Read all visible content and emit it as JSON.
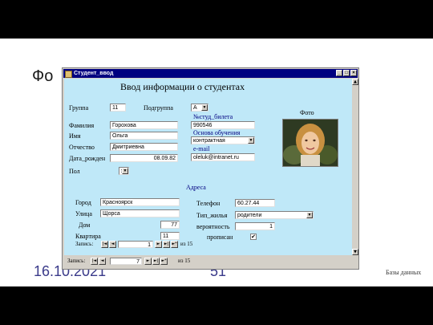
{
  "slide": {
    "title": "Фо",
    "date": "16.10.2021",
    "page": "51",
    "note": "Базы данных"
  },
  "window": {
    "title": "Студент_ввод",
    "minimize": "_",
    "maximize": "□",
    "close": "×"
  },
  "form": {
    "heading": "Ввод информации о студентах",
    "group_label": "Группа",
    "group_value": "11",
    "subgroup_label": "Подгруппа",
    "subgroup_value": "А",
    "surname_label": "Фамилия",
    "surname_value": "Горохова",
    "name_label": "Имя",
    "name_value": "Ольга",
    "patronymic_label": "Отчество",
    "patronymic_value": "Дмитриевна",
    "birthdate_label": "Дата_рожден",
    "birthdate_value": "08.09.82",
    "sex_label": "Пол",
    "sex_value": "ж",
    "ticket_label": "№студ_билета",
    "ticket_value": "990546",
    "study_basis_label": "Основа обучения",
    "study_basis_value": "контрактная",
    "email_label": "e-mail",
    "email_value": "oleluk@intranet.ru",
    "photo_label": "Фото",
    "address_heading": "Адреса",
    "city_label": "Город",
    "city_value": "Красноярск",
    "street_label": "Улица",
    "street_value": "Щорса",
    "house_label": "Дом",
    "house_value": "77",
    "apartment_label": "Квартира",
    "apartment_value": "11",
    "phone_label": "Телефон",
    "phone_value": "60.27.44",
    "housing_type_label": "Тип_жилья",
    "housing_type_value": "родители",
    "probability_label": "вероятность",
    "probability_value": "1",
    "registered_label": "прописан",
    "registered_value": "✔"
  },
  "subform_nav": {
    "record_label": "Запись:",
    "record_value": "1",
    "of_text": "из 15"
  },
  "main_nav": {
    "record_label": "Запись:",
    "record_value": "7",
    "of_text": "из 15"
  },
  "icons": {
    "first": "|◄",
    "prev": "◄",
    "next": "►",
    "last": "►|",
    "new": "►*",
    "dropdown": "▼",
    "scroll_up": "▲",
    "scroll_down": "▼"
  }
}
